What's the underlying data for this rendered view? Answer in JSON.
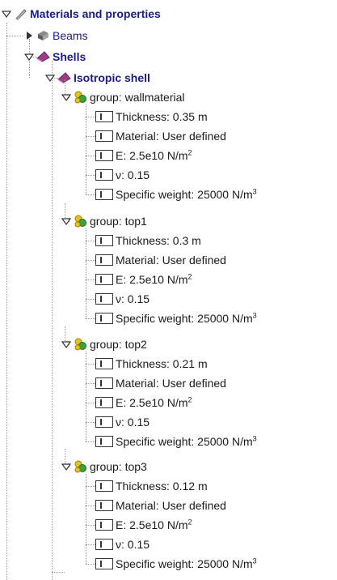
{
  "tree": {
    "root": {
      "label": "Materials and properties",
      "icon": "pen-icon"
    },
    "beams": {
      "label": "Beams",
      "icon": "beam-icon"
    },
    "shells": {
      "label": "Shells",
      "icon": "shell-icon"
    },
    "iso": {
      "label": "Isotropic shell",
      "icon": "shell-icon"
    },
    "groups": [
      {
        "label": "group: wallmaterial",
        "props": [
          {
            "text": "Thickness: 0.35 m",
            "sup": ""
          },
          {
            "text": "Material: User defined",
            "sup": ""
          },
          {
            "text": "E: 2.5e10 N/m",
            "sup": "2"
          },
          {
            "text": "ν: 0.15",
            "sup": ""
          },
          {
            "text": "Specific weight: 25000 N/m",
            "sup": "3"
          }
        ]
      },
      {
        "label": "group: top1",
        "props": [
          {
            "text": "Thickness: 0.3 m",
            "sup": ""
          },
          {
            "text": "Material: User defined",
            "sup": ""
          },
          {
            "text": "E: 2.5e10 N/m",
            "sup": "2"
          },
          {
            "text": "ν: 0.15",
            "sup": ""
          },
          {
            "text": "Specific weight: 25000 N/m",
            "sup": "3"
          }
        ]
      },
      {
        "label": "group: top2",
        "props": [
          {
            "text": "Thickness: 0.21 m",
            "sup": ""
          },
          {
            "text": "Material: User defined",
            "sup": ""
          },
          {
            "text": "E: 2.5e10 N/m",
            "sup": "2"
          },
          {
            "text": "ν: 0.15",
            "sup": ""
          },
          {
            "text": "Specific weight: 25000 N/m",
            "sup": "3"
          }
        ]
      },
      {
        "label": "group: top3",
        "props": [
          {
            "text": "Thickness: 0.12 m",
            "sup": ""
          },
          {
            "text": "Material: User defined",
            "sup": ""
          },
          {
            "text": "E: 2.5e10 N/m",
            "sup": "2"
          },
          {
            "text": "ν: 0.15",
            "sup": ""
          },
          {
            "text": "Specific weight: 25000 N/m",
            "sup": "3"
          }
        ]
      }
    ]
  },
  "colors": {
    "header": "#1b1b8a",
    "text": "#1a1a1a",
    "shell": "#9b3d86",
    "group_yellow": "#e8c21b",
    "group_green": "#3aa33a"
  }
}
